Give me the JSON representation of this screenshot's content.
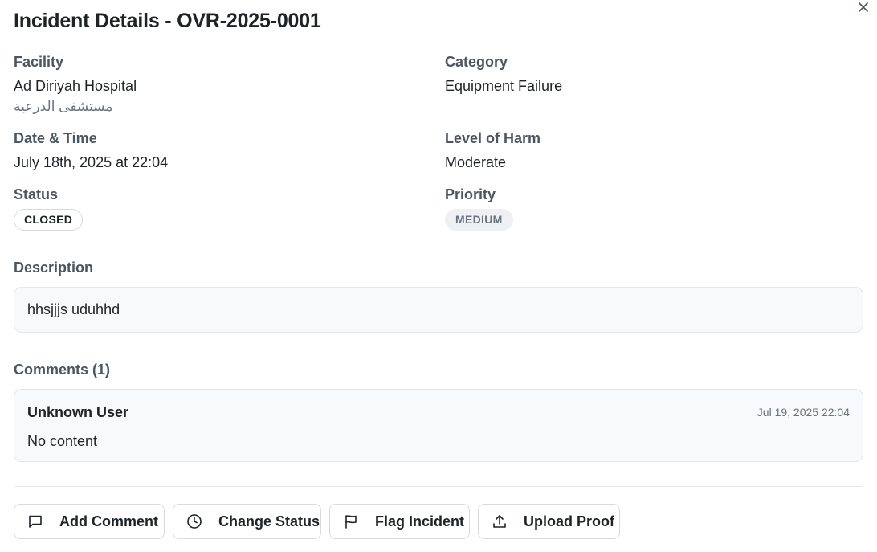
{
  "dialog": {
    "title": "Incident Details - OVR-2025-0001",
    "close_icon": "close-icon"
  },
  "fields": {
    "facility_label": "Facility",
    "facility_value": "Ad Diriyah Hospital",
    "facility_value_ar": "مستشفى الدرعية",
    "category_label": "Category",
    "category_value": "Equipment Failure",
    "datetime_label": "Date & Time",
    "datetime_value": "July 18th, 2025 at 22:04",
    "harm_label": "Level of Harm",
    "harm_value": "Moderate",
    "status_label": "Status",
    "status_value": "CLOSED",
    "priority_label": "Priority",
    "priority_value": "MEDIUM"
  },
  "description": {
    "label": "Description",
    "text": "hhsjjjs uduhhd"
  },
  "comments": {
    "label": "Comments (1)",
    "items": [
      {
        "author": "Unknown User",
        "date": "Jul 19, 2025 22:04",
        "body": "No content"
      }
    ]
  },
  "actions": {
    "add_comment": "Add Comment",
    "change_status": "Change Status",
    "flag_incident": "Flag Incident",
    "upload_proof": "Upload Proof"
  },
  "icons": {
    "add_comment": "message-square-icon",
    "change_status": "clock-icon",
    "flag_incident": "flag-icon",
    "upload_proof": "upload-icon"
  },
  "colors": {
    "badge_neutral_bg": "#eef0f3",
    "panel_bg": "#f8f9fa",
    "border": "#e3e6ea",
    "muted_text": "#6b7280"
  }
}
